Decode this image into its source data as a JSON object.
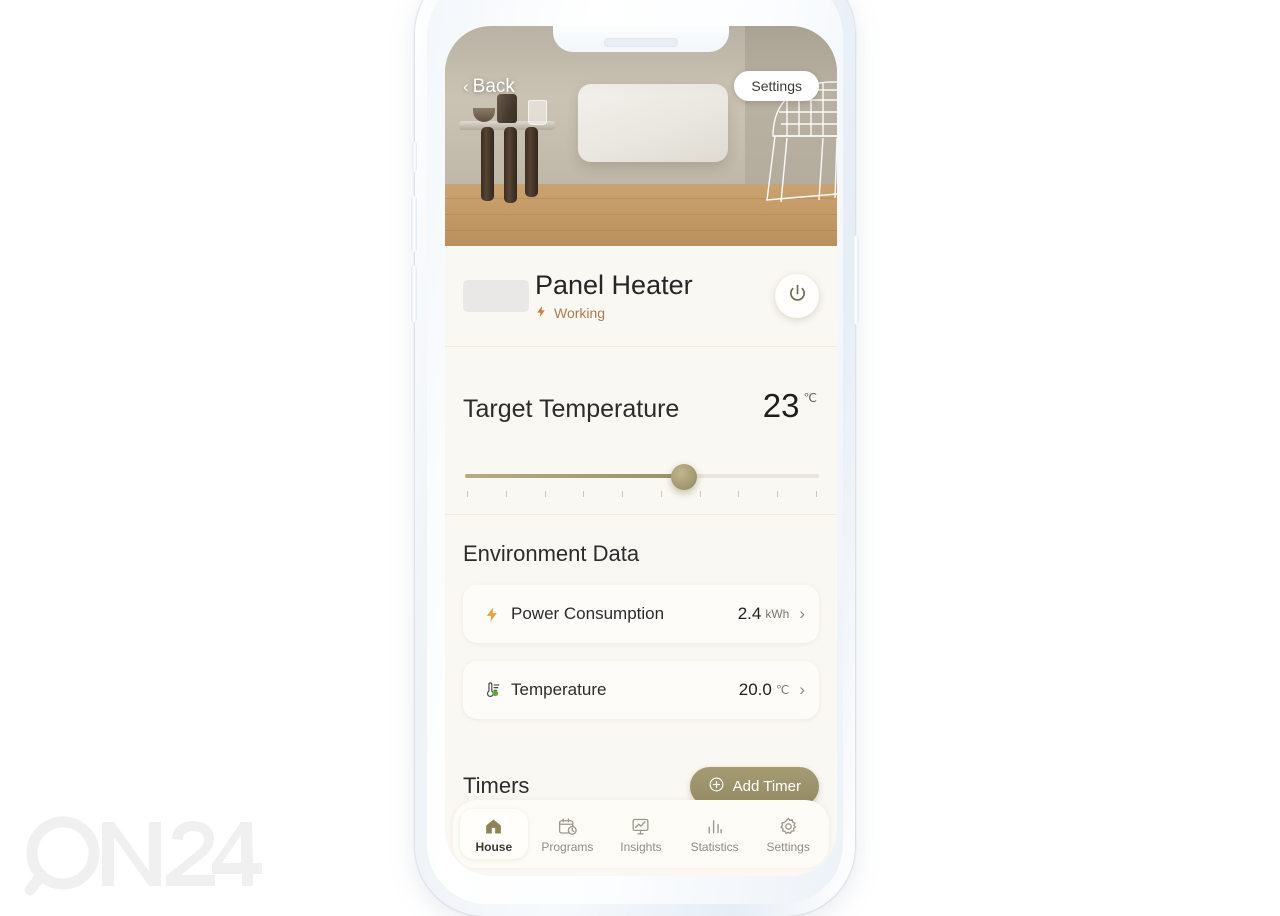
{
  "watermark": {
    "text": "ON24"
  },
  "hero": {
    "back_label": "Back",
    "back_chevron": "‹",
    "settings_label": "Settings",
    "scene_description": "panel-heater-living-room"
  },
  "device": {
    "name": "Panel Heater",
    "status": "Working",
    "status_icon": "bolt-icon",
    "power_icon": "power-icon"
  },
  "target_temperature": {
    "label": "Target Temperature",
    "value": "23",
    "unit": "℃",
    "slider": {
      "fill_percent": 62,
      "tick_count": 10
    }
  },
  "environment": {
    "title": "Environment Data",
    "rows": [
      {
        "icon": "bolt-icon",
        "label": "Power Consumption",
        "value": "2.4",
        "unit": "kWh",
        "chevron": "›"
      },
      {
        "icon": "thermometer-icon",
        "label": "Temperature",
        "value": "20.0",
        "unit": "℃",
        "chevron": "›"
      }
    ]
  },
  "timers": {
    "title": "Timers",
    "add_button": {
      "label": "Add Timer",
      "icon": "plus-circle-icon"
    }
  },
  "tabbar": {
    "items": [
      {
        "label": "House",
        "icon": "home-icon",
        "active": true
      },
      {
        "label": "Programs",
        "icon": "calendar-clock-icon",
        "active": false
      },
      {
        "label": "Insights",
        "icon": "presentation-chart-icon",
        "active": false
      },
      {
        "label": "Statistics",
        "icon": "bar-chart-icon",
        "active": false
      },
      {
        "label": "Settings",
        "icon": "gear-icon",
        "active": false
      }
    ]
  },
  "colors": {
    "accent_olive": "#9c9269",
    "status_orange": "#b07a4d",
    "bolt_amber": "#e8a13c",
    "screen_bg": "#faf8f2",
    "temperature_green": "#5fa832"
  }
}
